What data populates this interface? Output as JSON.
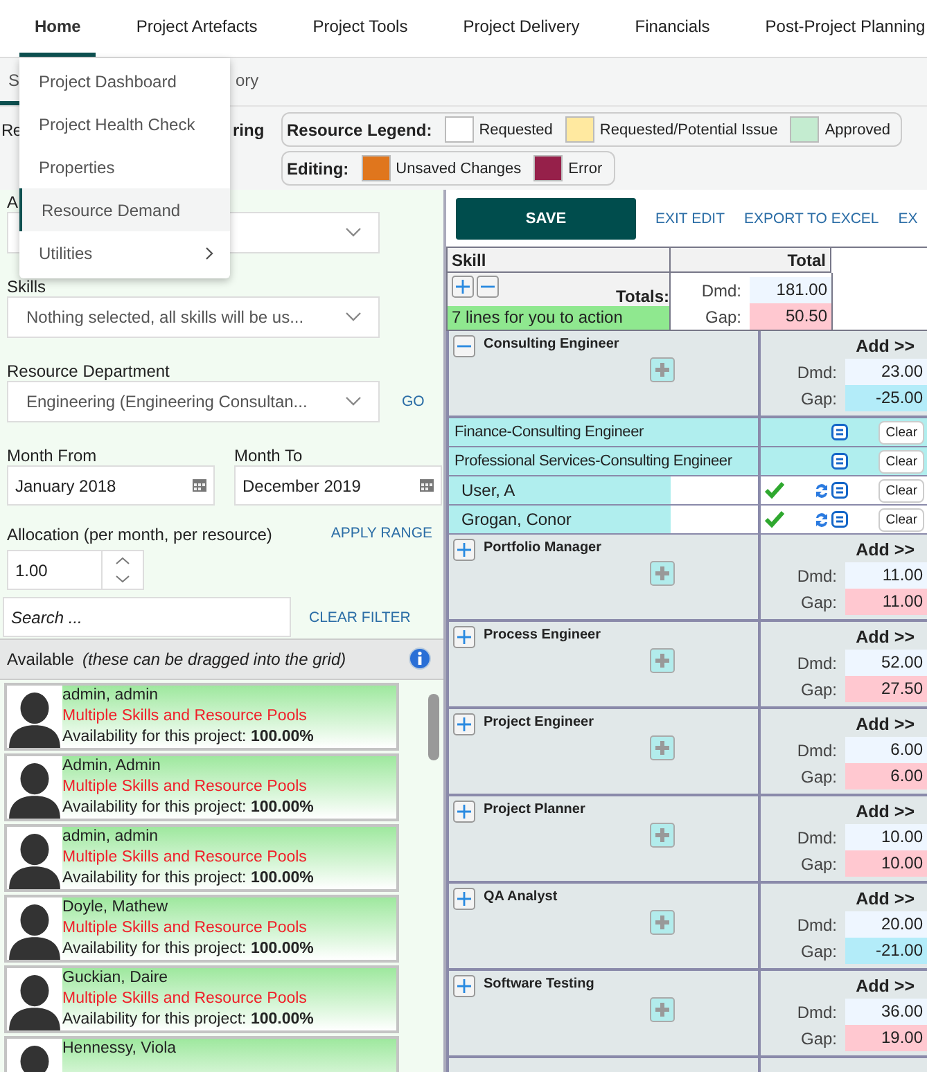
{
  "nav": {
    "items": [
      {
        "label": "Home",
        "selected": true
      },
      {
        "label": "Project Artefacts",
        "selected": false
      },
      {
        "label": "Project Tools",
        "selected": false
      },
      {
        "label": "Project Delivery",
        "selected": false
      },
      {
        "label": "Financials",
        "selected": false
      },
      {
        "label": "Post-Project Planning",
        "selected": false
      }
    ]
  },
  "menu": {
    "items": [
      {
        "label": "Project Dashboard",
        "selected": false,
        "has_submenu": false
      },
      {
        "label": "Project Health Check",
        "selected": false,
        "has_submenu": false
      },
      {
        "label": "Properties",
        "selected": false,
        "has_submenu": false
      },
      {
        "label": "Resource Demand",
        "selected": true,
        "has_submenu": false
      },
      {
        "label": "Utilities",
        "selected": false,
        "has_submenu": true
      }
    ]
  },
  "tabs": [
    {
      "label": "S",
      "selected": true
    },
    {
      "label": "ory",
      "selected": false
    }
  ],
  "header_fragments": [
    "Re",
    "ring"
  ],
  "resource_legend": {
    "title": "Resource Legend:",
    "items": [
      {
        "label": "Requested",
        "color": "#ffffff"
      },
      {
        "label": "Requested/Potential Issue",
        "color": "#ffe9a0"
      },
      {
        "label": "Approved",
        "color": "#c4ecd0"
      }
    ]
  },
  "editing_legend": {
    "title": "Editing:",
    "items": [
      {
        "label": "Unsaved Changes",
        "color": "#e0761d"
      },
      {
        "label": "Error",
        "color": "#96204a"
      }
    ]
  },
  "filters": {
    "first_label": "A",
    "skills": {
      "label": "Skills",
      "value": "Nothing selected, all skills will be us..."
    },
    "department": {
      "label": "Resource Department",
      "value": "Engineering (Engineering Consultan..."
    },
    "go": "GO",
    "month_from": {
      "label": "Month From",
      "value": "January 2018"
    },
    "month_to": {
      "label": "Month To",
      "value": "December 2019"
    },
    "allocation": {
      "label": "Allocation (per month, per resource)",
      "value": "1.00"
    },
    "apply_range": "APPLY RANGE",
    "search": {
      "placeholder": "Search ..."
    },
    "clear_filter": "CLEAR FILTER"
  },
  "available": {
    "title": "Available",
    "note": "(these can be dragged into the grid)"
  },
  "resources": [
    {
      "name": "admin, admin",
      "skills": "Multiple Skills and Resource Pools",
      "availability_label": "Availability for this project:",
      "availability": "100.00%"
    },
    {
      "name": "Admin, Admin",
      "skills": "Multiple Skills and Resource Pools",
      "availability_label": "Availability for this project:",
      "availability": "100.00%"
    },
    {
      "name": "admin, admin",
      "skills": "Multiple Skills and Resource Pools",
      "availability_label": "Availability for this project:",
      "availability": "100.00%"
    },
    {
      "name": "Doyle, Mathew",
      "skills": "Multiple Skills and Resource Pools",
      "availability_label": "Availability for this project:",
      "availability": "100.00%"
    },
    {
      "name": "Guckian, Daire",
      "skills": "Multiple Skills and Resource Pools",
      "availability_label": "Availability for this project:",
      "availability": "100.00%"
    },
    {
      "name": "Hennessy, Viola"
    }
  ],
  "actions": {
    "save": "SAVE",
    "links": [
      "EXIT EDIT",
      "EXPORT TO EXCEL",
      "EX"
    ]
  },
  "grid": {
    "columns": [
      "Skill",
      "Total"
    ],
    "totals_label": "Totals:",
    "action_note": "7 lines for you to action",
    "dmd_label": "Dmd:",
    "gap_label": "Gap:",
    "dmd": "181.00",
    "gap": {
      "value": "50.50",
      "color": "#ffc8d0"
    },
    "groups": [
      {
        "name": "Consulting Engineer",
        "expanded": true,
        "add": "Add >>",
        "dmd_label": "Dmd:",
        "dmd": "23.00",
        "gap_label": "Gap:",
        "gap": {
          "value": "-25.00",
          "color": "#b3ecf9"
        },
        "children": [
          {
            "kind": "pool",
            "name": "Finance-Consulting Engineer",
            "clear": "Clear"
          },
          {
            "kind": "pool",
            "name": "Professional Services-Consulting Engineer",
            "clear": "Clear"
          },
          {
            "kind": "person",
            "name": "User, A",
            "approved": true,
            "clear": "Clear"
          },
          {
            "kind": "person",
            "name": "Grogan, Conor",
            "approved": true,
            "clear": "Clear"
          }
        ]
      },
      {
        "name": "Portfolio Manager",
        "expanded": false,
        "add": "Add >>",
        "dmd_label": "Dmd:",
        "dmd": "11.00",
        "gap_label": "Gap:",
        "gap": {
          "value": "11.00",
          "color": "#ffc8d0"
        }
      },
      {
        "name": "Process Engineer",
        "expanded": false,
        "add": "Add >>",
        "dmd_label": "Dmd:",
        "dmd": "52.00",
        "gap_label": "Gap:",
        "gap": {
          "value": "27.50",
          "color": "#ffc8d0"
        }
      },
      {
        "name": "Project Engineer",
        "expanded": false,
        "add": "Add >>",
        "dmd_label": "Dmd:",
        "dmd": "6.00",
        "gap_label": "Gap:",
        "gap": {
          "value": "6.00",
          "color": "#ffc8d0"
        }
      },
      {
        "name": "Project Planner",
        "expanded": false,
        "add": "Add >>",
        "dmd_label": "Dmd:",
        "dmd": "10.00",
        "gap_label": "Gap:",
        "gap": {
          "value": "10.00",
          "color": "#ffc8d0"
        }
      },
      {
        "name": "QA Analyst",
        "expanded": false,
        "add": "Add >>",
        "dmd_label": "Dmd:",
        "dmd": "20.00",
        "gap_label": "Gap:",
        "gap": {
          "value": "-21.00",
          "color": "#b3ecf9"
        }
      },
      {
        "name": "Software Testing",
        "expanded": false,
        "add": "Add >>",
        "dmd_label": "Dmd:",
        "dmd": "36.00",
        "gap_label": "Gap:",
        "gap": {
          "value": "19.00",
          "color": "#ffc8d0"
        }
      }
    ]
  }
}
